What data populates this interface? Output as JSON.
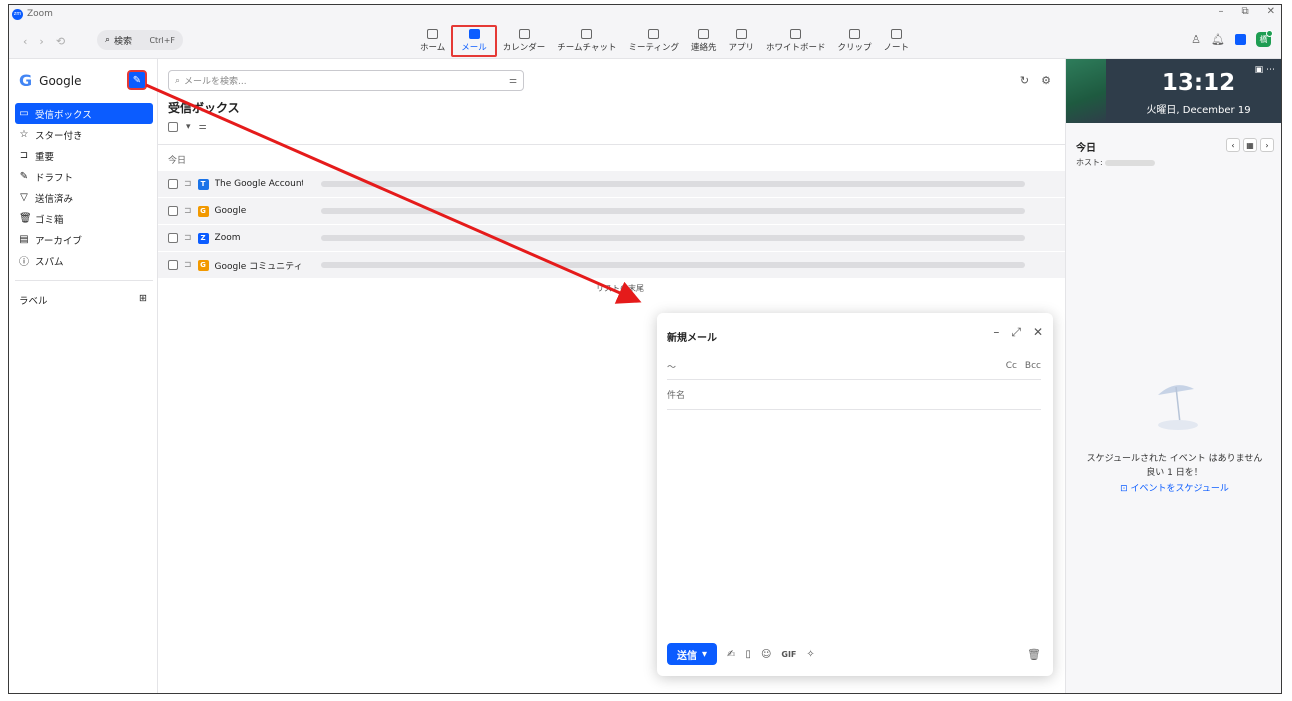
{
  "window": {
    "app_name": "Zoom",
    "controls": [
      "–",
      "⧉",
      "✕"
    ]
  },
  "toolbar": {
    "back": "‹",
    "forward": "›",
    "history": "⟲",
    "search_label": "検索",
    "search_shortcut": "Ctrl+F",
    "tabs": [
      {
        "label": "ホーム",
        "icon": "home-icon"
      },
      {
        "label": "メール",
        "icon": "mail-icon"
      },
      {
        "label": "カレンダー",
        "icon": "calendar-icon"
      },
      {
        "label": "チームチャット",
        "icon": "chat-icon"
      },
      {
        "label": "ミーティング",
        "icon": "video-icon"
      },
      {
        "label": "連絡先",
        "icon": "contacts-icon"
      },
      {
        "label": "アプリ",
        "icon": "apps-icon"
      },
      {
        "label": "ホワイトボード",
        "icon": "whiteboard-icon"
      },
      {
        "label": "クリップ",
        "icon": "clips-icon"
      },
      {
        "label": "ノート",
        "icon": "notes-icon"
      }
    ],
    "active_tab": "メール",
    "avatar_initial": "橋"
  },
  "sidebar": {
    "account_name": "Google",
    "compose_icon": "pencil-icon",
    "folders": [
      {
        "label": "受信ボックス",
        "icon": "▭"
      },
      {
        "label": "スター付き",
        "icon": "☆"
      },
      {
        "label": "重要",
        "icon": "⊐"
      },
      {
        "label": "ドラフト",
        "icon": "✎"
      },
      {
        "label": "送信済み",
        "icon": "▽"
      },
      {
        "label": "ゴミ箱",
        "icon": "🗑"
      },
      {
        "label": "アーカイブ",
        "icon": "▤"
      },
      {
        "label": "スパム",
        "icon": "ⓘ"
      }
    ],
    "labels_title": "ラベル",
    "add_label": "⊞"
  },
  "mail": {
    "search_placeholder": "メールを検索...",
    "inbox_title": "受信ボックス",
    "group_today": "今日",
    "rows": [
      {
        "sender": "The Google Account T...",
        "badge": "T",
        "badge_color": "#1a73e8"
      },
      {
        "sender": "Google",
        "badge": "G",
        "badge_color": "#f29900"
      },
      {
        "sender": "Zoom",
        "badge": "Z",
        "badge_color": "#0b5cff"
      },
      {
        "sender": "Google コミュニティ チーム",
        "badge": "G",
        "badge_color": "#f29900"
      }
    ],
    "end_of_list": "リストの末尾"
  },
  "right_panel": {
    "time": "13:12",
    "date": "火曜日, December 19",
    "today": "今日",
    "host_label": "ホスト:",
    "empty_line1": "スケジュールされた イベント はありません",
    "empty_line2": "良い 1 日を！",
    "schedule_link": "⊡ イベントをスケジュール"
  },
  "compose": {
    "title": "新規メール",
    "to_placeholder": "～",
    "cc": "Cc",
    "bcc": "Bcc",
    "subject_placeholder": "件名",
    "send_label": "送信",
    "gif": "GIF"
  },
  "colors": {
    "accent": "#0b5cff",
    "highlight": "#e53935"
  }
}
